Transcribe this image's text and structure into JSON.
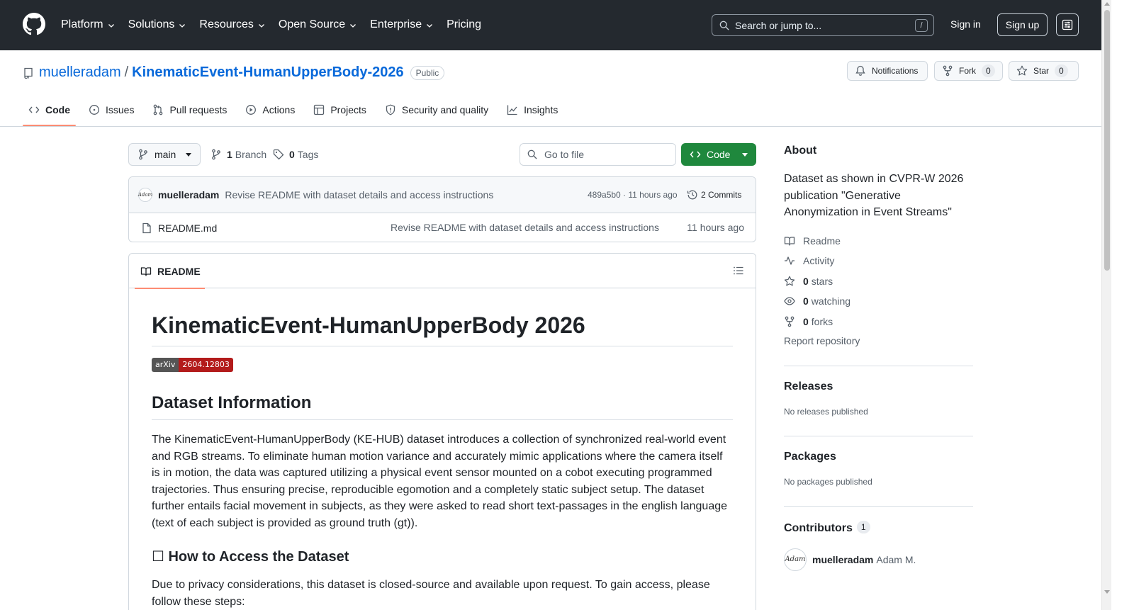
{
  "header": {
    "nav": [
      "Platform",
      "Solutions",
      "Resources",
      "Open Source",
      "Enterprise"
    ],
    "pricing": "Pricing",
    "search_placeholder": "Search or jump to...",
    "search_key": "/",
    "sign_in": "Sign in",
    "sign_up": "Sign up"
  },
  "repo": {
    "owner": "muelleradam",
    "separator": "/",
    "name": "KinematicEvent-HumanUpperBody-2026",
    "visibility": "Public",
    "notifications_label": "Notifications",
    "fork_label": "Fork",
    "fork_count": "0",
    "star_label": "Star",
    "star_count": "0"
  },
  "tabs": [
    {
      "label": "Code",
      "icon": "code-icon",
      "active": true
    },
    {
      "label": "Issues",
      "icon": "issue-icon"
    },
    {
      "label": "Pull requests",
      "icon": "pull-request-icon"
    },
    {
      "label": "Actions",
      "icon": "play-icon"
    },
    {
      "label": "Projects",
      "icon": "table-icon"
    },
    {
      "label": "Security and quality",
      "icon": "shield-icon"
    },
    {
      "label": "Insights",
      "icon": "graph-icon"
    }
  ],
  "files": {
    "branch": "main",
    "branch_count": "1",
    "branch_label": "Branch",
    "tag_count": "0",
    "tag_label": "Tags",
    "goto_placeholder": "Go to file",
    "code_button": "Code",
    "commit": {
      "avatar_text": "Adam",
      "author": "muelleradam",
      "message": "Revise README with dataset details and access instructions",
      "hash_age": "489a5b0 · 11 hours ago",
      "commits_label": "2 Commits"
    },
    "entries": [
      {
        "name": "README.md",
        "message": "Revise README with dataset details and access instructions",
        "age": "11 hours ago"
      }
    ]
  },
  "readme": {
    "tab_label": "README",
    "title": "KinematicEvent-HumanUpperBody 2026",
    "badge_left": "arXiv",
    "badge_right": "2604.12803",
    "section1": "Dataset Information",
    "para1": "The KinematicEvent-HumanUpperBody (KE-HUB) dataset introduces a collection of synchronized real-world event and RGB streams. To eliminate human motion variance and accurately mimic applications where the camera itself is in motion, the data was captured utilizing a physical event sensor mounted on a cobot executing programmed trajectories. Thus ensuring precise, reproducible egomotion and a completely static subject setup. The dataset further entails facial movement in subjects, as they were asked to read short text-passages in the english language (text of each subject is provided as ground truth (gt)).",
    "section2": "☐ How to Access the Dataset",
    "para2": "Due to privacy considerations, this dataset is closed-source and available upon request. To gain access, please follow these steps:"
  },
  "sidebar": {
    "about_title": "About",
    "about_desc": "Dataset as shown in CVPR-W 2026 publication \"Generative Anonymization in Event Streams\"",
    "readme_link": "Readme",
    "activity_link": "Activity",
    "stars_count": "0",
    "stars_label": "stars",
    "watching_count": "0",
    "watching_label": "watching",
    "forks_count": "0",
    "forks_label": "forks",
    "report": "Report repository",
    "releases_title": "Releases",
    "releases_note": "No releases published",
    "packages_title": "Packages",
    "packages_note": "No packages published",
    "contributors_title": "Contributors",
    "contributors_count": "1",
    "contributor_avatar_text": "Adam",
    "contributor_login": "muelleradam",
    "contributor_name": "Adam M."
  },
  "colors": {
    "header_bg": "#24292f",
    "link": "#0969da",
    "primary_button": "#1f883d",
    "active_tab_underline": "#fd8c73",
    "arxiv_badge": "#b31b1b"
  }
}
